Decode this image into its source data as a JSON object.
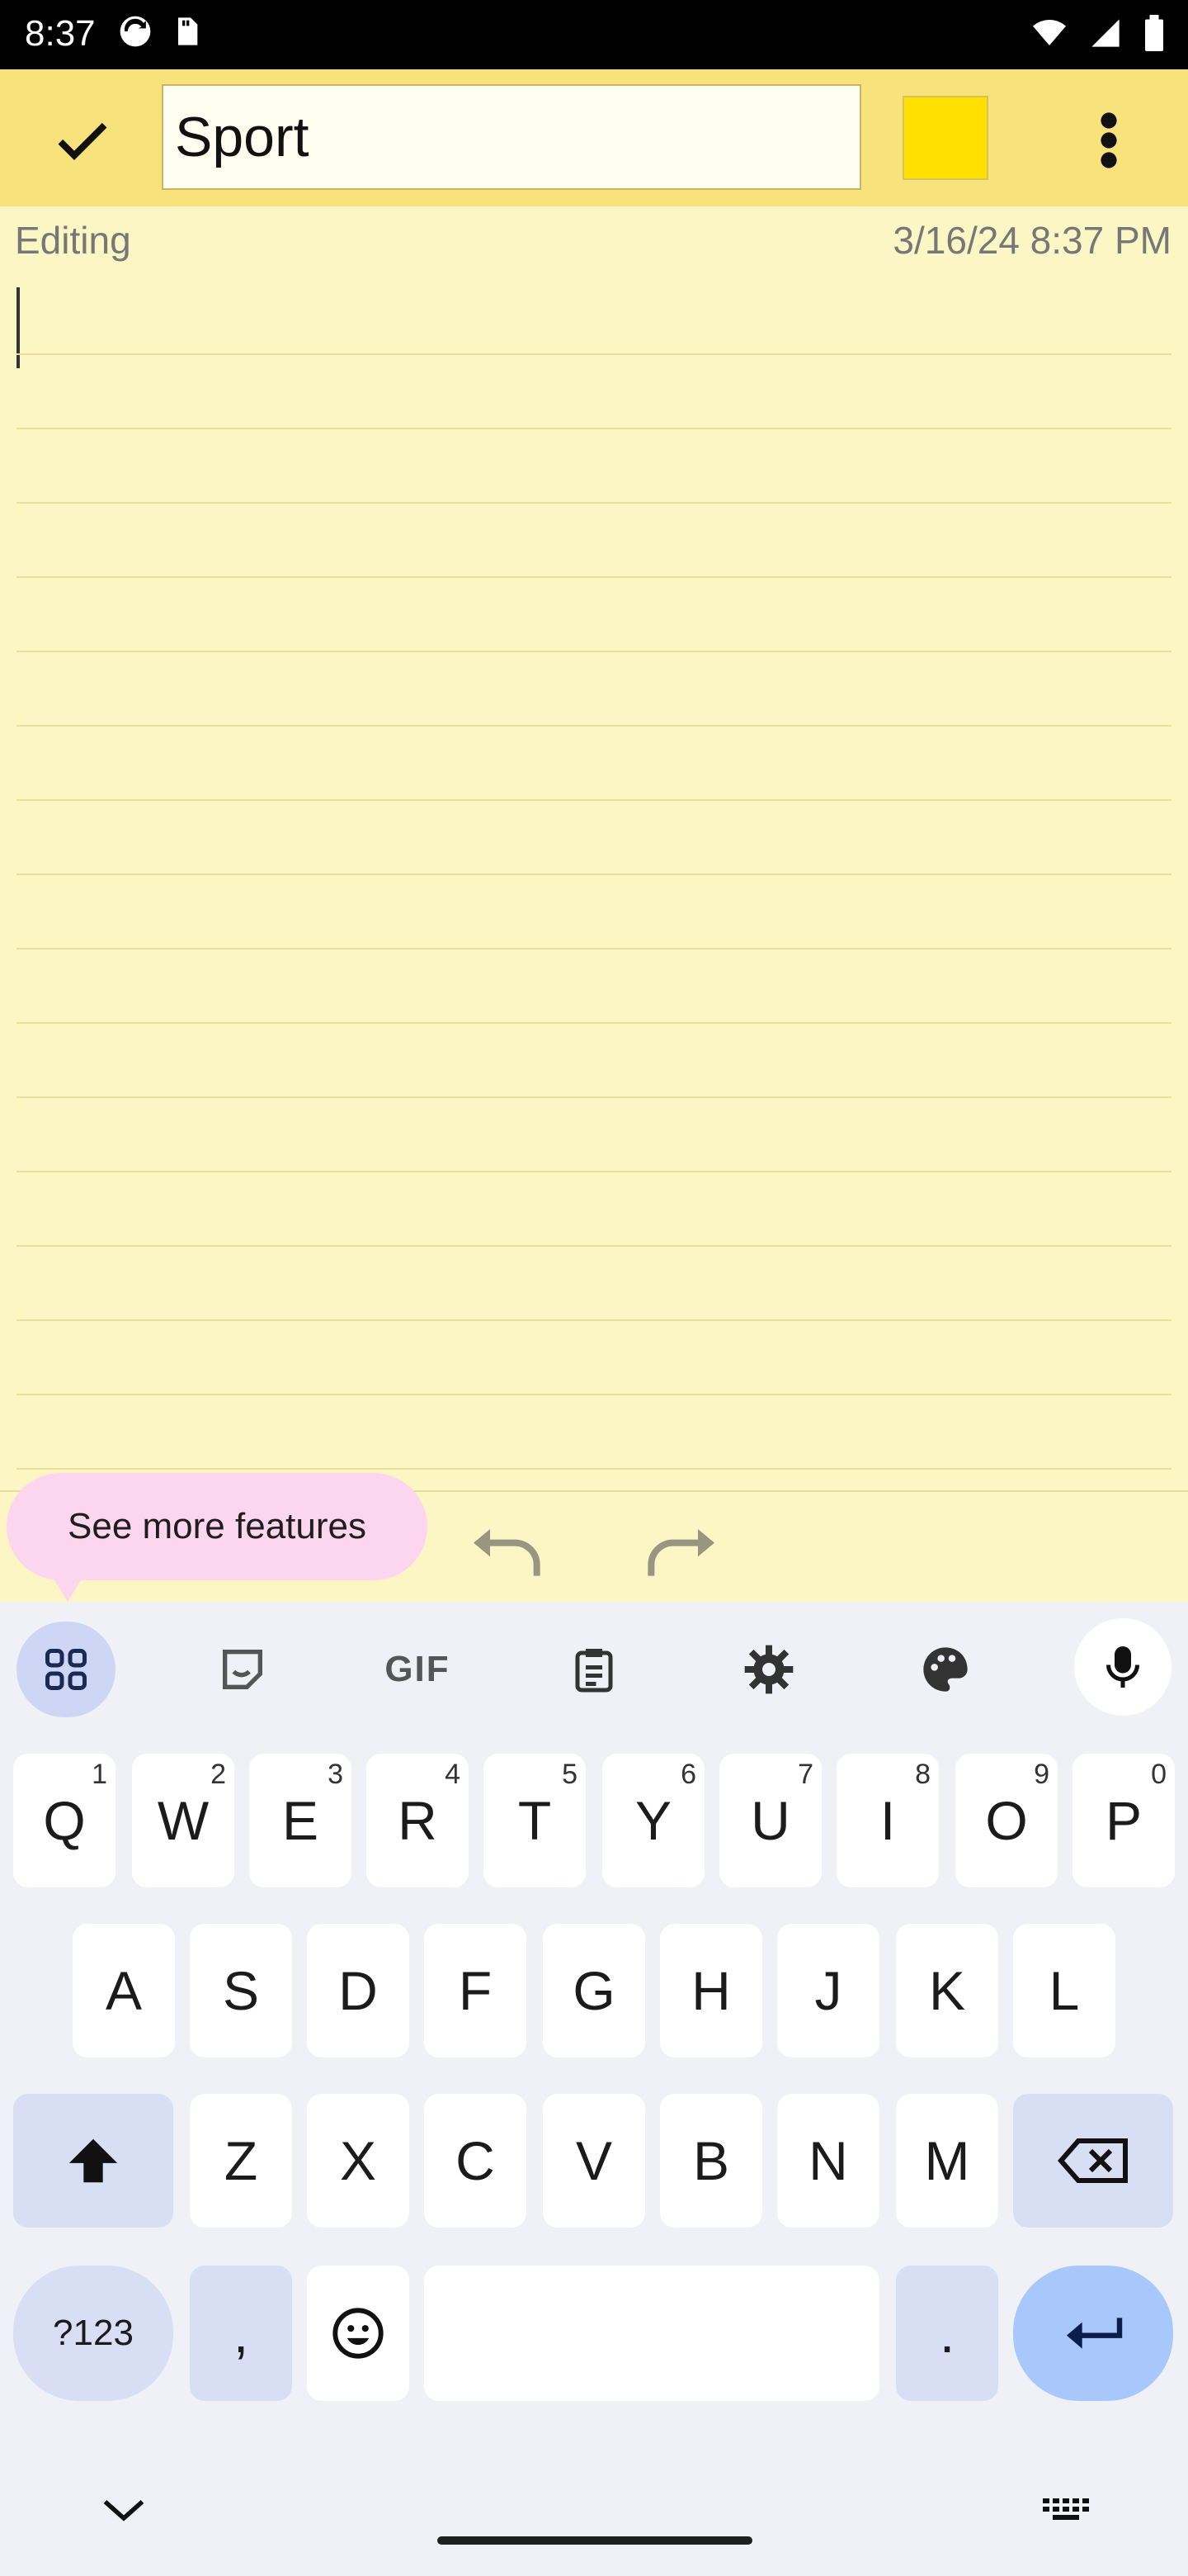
{
  "status_bar": {
    "time": "8:37"
  },
  "toolbar": {
    "confirm_icon": "check-icon",
    "title_value": "Sport",
    "color_swatch": "#ffe000",
    "more_icon": "more-vert-icon"
  },
  "note": {
    "mode_label": "Editing",
    "timestamp": "3/16/24 8:37 PM",
    "body_text": ""
  },
  "edit_bar": {
    "tooltip": "See more features",
    "undo_icon": "undo-icon",
    "redo_icon": "redo-icon"
  },
  "keyboard": {
    "toolbar": [
      "apps-icon",
      "sticker-icon",
      "gif-icon",
      "clipboard-icon",
      "settings-icon",
      "palette-icon",
      "mic-icon"
    ],
    "gif_label": "GIF",
    "row1": [
      {
        "k": "Q",
        "h": "1"
      },
      {
        "k": "W",
        "h": "2"
      },
      {
        "k": "E",
        "h": "3"
      },
      {
        "k": "R",
        "h": "4"
      },
      {
        "k": "T",
        "h": "5"
      },
      {
        "k": "Y",
        "h": "6"
      },
      {
        "k": "U",
        "h": "7"
      },
      {
        "k": "I",
        "h": "8"
      },
      {
        "k": "O",
        "h": "9"
      },
      {
        "k": "P",
        "h": "0"
      }
    ],
    "row2": [
      "A",
      "S",
      "D",
      "F",
      "G",
      "H",
      "J",
      "K",
      "L"
    ],
    "row3": [
      "Z",
      "X",
      "C",
      "V",
      "B",
      "N",
      "M"
    ],
    "symbols_label": "?123",
    "comma_label": ",",
    "period_label": "."
  },
  "colors": {
    "toolbar_bg": "#f8e27b",
    "note_bg": "#fbf6c4",
    "accent": "#a8c7fa"
  }
}
